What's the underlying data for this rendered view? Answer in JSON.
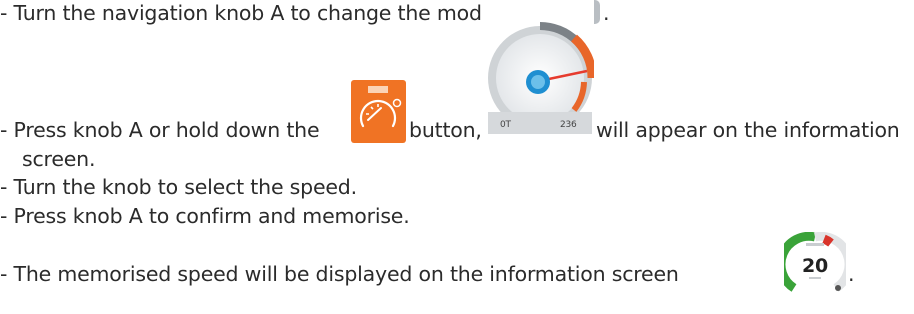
{
  "instructions": [
    {
      "before": "- Turn the navigation knob A to change the mode",
      "after": "."
    },
    {
      "before": "- Press knob A or hold down the",
      "middle": "button,",
      "after": "will appear on the information"
    },
    {
      "continuation": "screen."
    },
    {
      "text": "- Turn the knob to select the speed."
    },
    {
      "text": "- Press knob A to confirm and memorise."
    },
    {
      "before": "- The memorised speed will be displayed on the information screen",
      "after": "."
    }
  ],
  "icons": {
    "steering_wheel": {
      "name": "steering-wheel-icon",
      "color": "#8e959b"
    },
    "speed_limiter_button": {
      "name": "speedometer-icon",
      "color": "#f26f21"
    },
    "speed_gauge": {
      "name": "speed-gauge-display",
      "left_label": "0T",
      "right_label": "236",
      "accent": "#e8662a",
      "knob": "#1f8fd1"
    },
    "memorised_speed": {
      "name": "memorised-speed-gauge",
      "value": "20",
      "arc_color": "#3aa339",
      "marker_color": "#d9342b"
    }
  }
}
